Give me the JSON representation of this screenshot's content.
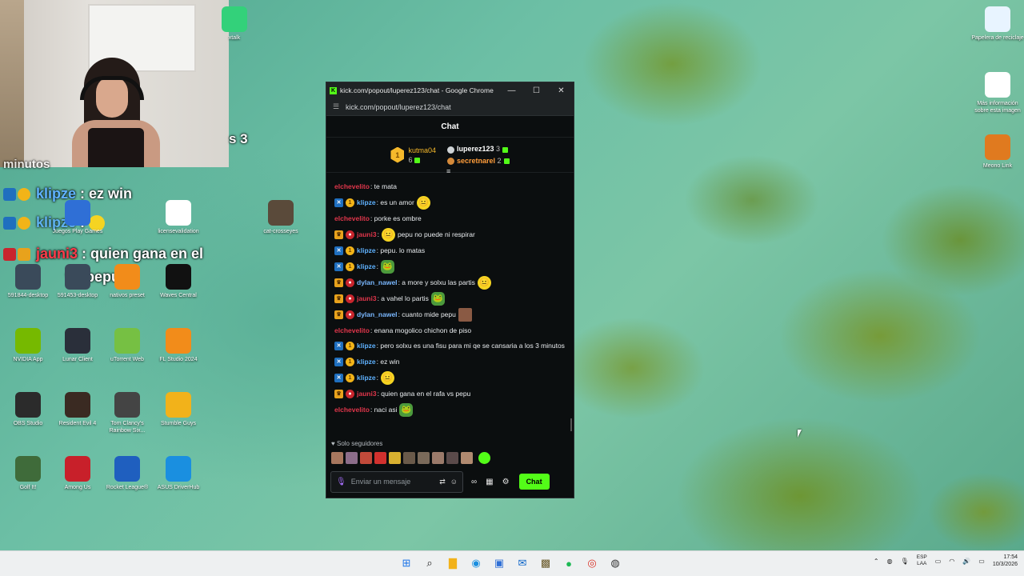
{
  "desktop_icons": [
    {
      "label": "xtalk",
      "icon": "green-app-icon",
      "color": "#33d17a"
    },
    {
      "label": "Papelera de reciclaje",
      "icon": "recycle-bin-icon",
      "color": "#e8f4ff"
    },
    {
      "label": "Más información sobre esta imagen",
      "icon": "info-camera-icon",
      "color": "#ffffff"
    },
    {
      "label": "Meono Link",
      "icon": "meono-link-icon",
      "color": "#e07a1f"
    },
    {
      "label": "Juegos Play Games",
      "icon": "play-games-icon",
      "color": "#2f6fd6"
    },
    {
      "label": "licensevalidation",
      "icon": "document-icon",
      "color": "#ffffff"
    },
    {
      "label": "cat-crosseyes",
      "icon": "cat-image-icon",
      "color": "#5a4a3a"
    },
    {
      "label": "591844-desktop",
      "icon": "screenshot-icon",
      "color": "#3a4a5a"
    },
    {
      "label": "591453-desktop",
      "icon": "screenshot-icon",
      "color": "#3a4a5a"
    },
    {
      "label": "nativos preset",
      "icon": "fl-preset-icon",
      "color": "#f28c1a"
    },
    {
      "label": "Waves Central",
      "icon": "waves-icon",
      "color": "#111111"
    },
    {
      "label": "NVIDIA App",
      "icon": "nvidia-icon",
      "color": "#76b900"
    },
    {
      "label": "Lunar Client",
      "icon": "lunar-client-icon",
      "color": "#2a2f3a"
    },
    {
      "label": "uTorrent Web",
      "icon": "utorrent-icon",
      "color": "#76c043"
    },
    {
      "label": "FL Studio 2024",
      "icon": "fl-studio-icon",
      "color": "#f28c1a"
    },
    {
      "label": "OBS Studio",
      "icon": "obs-icon",
      "color": "#2b2b2b"
    },
    {
      "label": "Resident Evil 4",
      "icon": "re4-icon",
      "color": "#3a2a22"
    },
    {
      "label": "Tom Clancy's Rainbow Six...",
      "icon": "rainbow-six-icon",
      "color": "#444444"
    },
    {
      "label": "Stumble Guys",
      "icon": "stumble-guys-icon",
      "color": "#f2b21a"
    },
    {
      "label": "Golf It!",
      "icon": "golf-it-icon",
      "color": "#3f6b3a"
    },
    {
      "label": "Among Us",
      "icon": "among-us-icon",
      "color": "#c8202a"
    },
    {
      "label": "Rocket League®",
      "icon": "rocket-league-icon",
      "color": "#1f5fbf"
    },
    {
      "label": "ASUS DriverHub",
      "icon": "asus-icon",
      "color": "#1a8fe0"
    }
  ],
  "overlay": {
    "fragment_a": "s 3",
    "fragment_b": "minutos",
    "lines": [
      {
        "user": "klipze",
        "text": " : ez win",
        "color": "#5fb2ff"
      },
      {
        "user": "klipze",
        "text": " : ",
        "color": "#5fb2ff"
      },
      {
        "user": "jauni3",
        "text": " : quien gana en el",
        "color": "#ff3b4a"
      },
      {
        "user": "",
        "text": "vs pepu",
        "color": "#ffffff"
      }
    ]
  },
  "chrome": {
    "title": "kick.com/popout/luperez123/chat - Google Chrome",
    "url": "kick.com/popout/luperez123/chat",
    "minimize": "—",
    "maximize": "☐",
    "close": "✕"
  },
  "chat": {
    "header": "Chat",
    "top_gifter": {
      "rank": "1",
      "name": "kutma04",
      "count": "6"
    },
    "gifters": [
      {
        "name": "luperez123",
        "count": "3",
        "color": "#ffffff"
      },
      {
        "name": "secretnarel",
        "count": "2",
        "color": "#ff9d3b"
      }
    ],
    "messages": [
      {
        "user": "elchevelito",
        "color": "#e0364b",
        "badges": [],
        "text": ": te mata"
      },
      {
        "user": "klipze",
        "color": "#5fb2ff",
        "badges": [
          "vip",
          "gold"
        ],
        "text": ": es un amor",
        "emote": "yellow"
      },
      {
        "user": "elchevelito",
        "color": "#e0364b",
        "badges": [],
        "text": ": porke es ombre"
      },
      {
        "user": "jauni3",
        "color": "#e0364b",
        "badges": [
          "crown",
          "red"
        ],
        "text": ": ",
        "emote": "yellow",
        "text2": " pepu no puede ni respirar"
      },
      {
        "user": "klipze",
        "color": "#5fb2ff",
        "badges": [
          "vip",
          "gold"
        ],
        "text": ": pepu. lo matas"
      },
      {
        "user": "klipze",
        "color": "#5fb2ff",
        "badges": [
          "vip",
          "gold"
        ],
        "text": ": ",
        "emote": "pepe"
      },
      {
        "user": "dylan_nawel",
        "color": "#7ab8ff",
        "badges": [
          "crown",
          "red"
        ],
        "text": ": a more y solxu las partis",
        "emote": "yellow"
      },
      {
        "user": "jauni3",
        "color": "#e0364b",
        "badges": [
          "crown",
          "red"
        ],
        "text": ": a vahel lo partis",
        "emote": "pepe"
      },
      {
        "user": "dylan_nawel",
        "color": "#7ab8ff",
        "badges": [
          "crown",
          "red"
        ],
        "text": ": cuanto mide pepu",
        "emote": "pic"
      },
      {
        "user": "elchevelito",
        "color": "#e0364b",
        "badges": [],
        "text": ": enana mogolico chichon de piso"
      },
      {
        "user": "klipze",
        "color": "#5fb2ff",
        "badges": [
          "vip",
          "gold"
        ],
        "text": ": pero solxu es una fisu para mi qe se cansaria a los 3 minutos",
        "multi": true
      },
      {
        "user": "klipze",
        "color": "#5fb2ff",
        "badges": [
          "vip",
          "gold"
        ],
        "text": ": ez win"
      },
      {
        "user": "klipze",
        "color": "#5fb2ff",
        "badges": [
          "vip",
          "gold"
        ],
        "text": ": ",
        "emote": "yellow"
      },
      {
        "user": "jauni3",
        "color": "#e0364b",
        "badges": [
          "crown",
          "red"
        ],
        "text": ": quien gana en el rafa vs pepu"
      },
      {
        "user": "elchevelito",
        "color": "#e0364b",
        "badges": [],
        "text": ": naci asi",
        "emote": "pepe"
      }
    ],
    "followers_only": "Solo seguidores",
    "input_placeholder": "Enviar un mensaje",
    "send_label": "Chat"
  },
  "taskbar": {
    "apps": [
      "windows-start-icon",
      "search-icon",
      "file-explorer-icon",
      "edge-icon",
      "store-icon",
      "outlook-icon",
      "minecraft-icon",
      "spotify-icon",
      "chrome-icon",
      "obs-taskbar-icon"
    ],
    "lang_top": "ESP",
    "lang_bottom": "LAA",
    "time": "17:54",
    "date": "10/3/2026"
  }
}
